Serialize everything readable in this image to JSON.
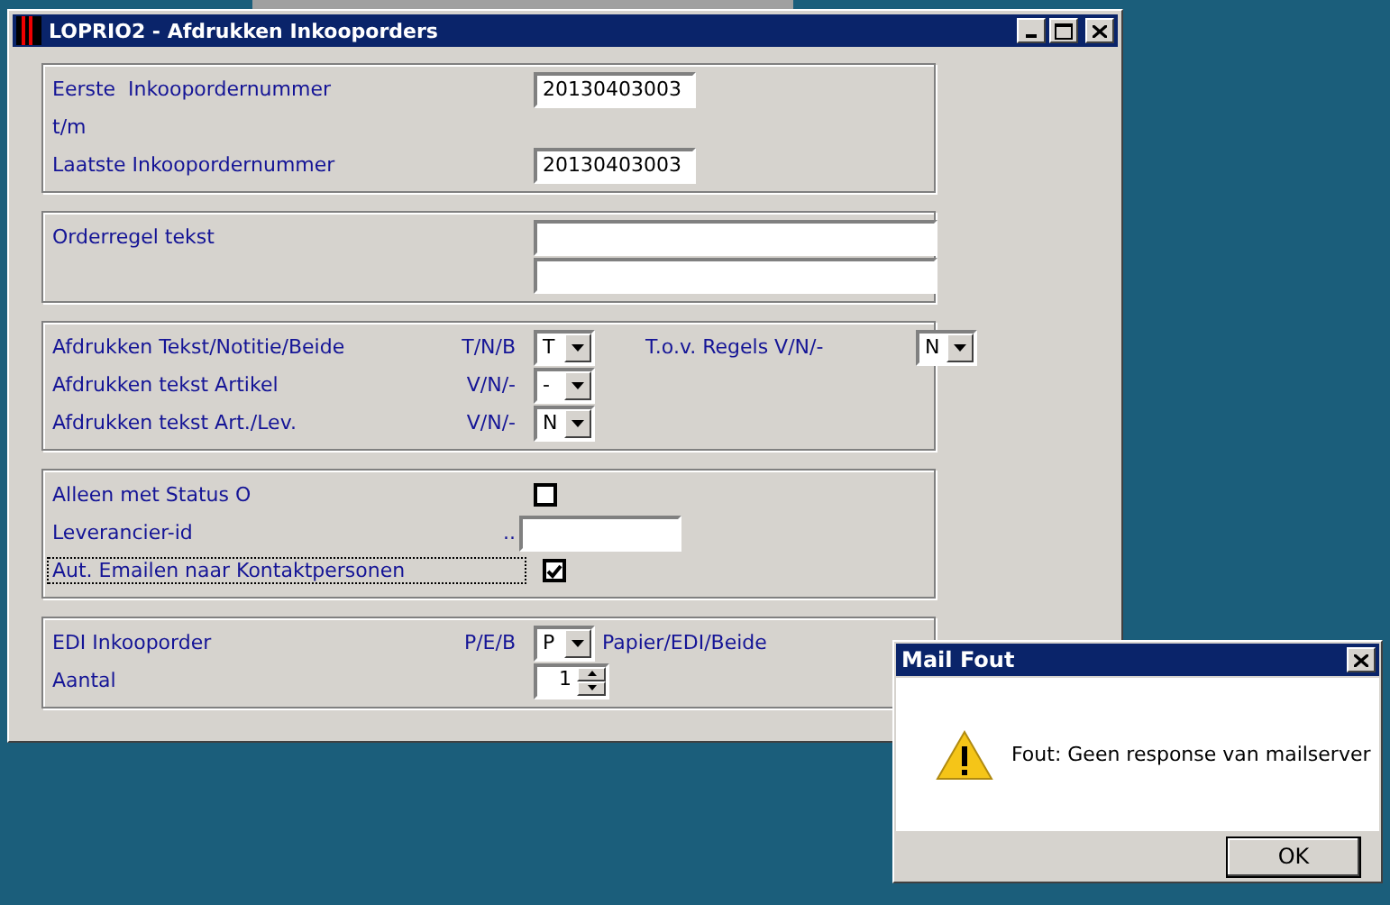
{
  "window": {
    "title": "LOPRIO2 - Afdrukken Inkooporders"
  },
  "order_range": {
    "first_label": "Eerste  Inkoopordernummer",
    "first_value": "20130403003",
    "between": "t/m",
    "last_label": "Laatste Inkoopordernummer",
    "last_value": "20130403003"
  },
  "orderline": {
    "label": "Orderregel tekst"
  },
  "print_options": [
    {
      "label": "Afdrukken Tekst/Notitie/Beide",
      "codes": "T/N/B",
      "value": "T"
    },
    {
      "label": "Afdrukken tekst Artikel",
      "codes": "V/N/-",
      "value": "-"
    },
    {
      "label": "Afdrukken tekst Art./Lev.",
      "codes": "V/N/-",
      "value": "N"
    }
  ],
  "rules_option": {
    "label": "T.o.v. Regels V/N/-",
    "value": "N"
  },
  "filters": {
    "status": {
      "label": "Alleen met Status O",
      "checked": false
    },
    "supplier": {
      "label": "Leverancier-id",
      "dots": ".."
    },
    "auto_email": {
      "label": "Aut. Emailen naar Kontaktpersonen",
      "checked": true,
      "focused": true
    }
  },
  "edi": {
    "label": "EDI Inkooporder",
    "codes": "P/E/B",
    "value": "P",
    "hint": "Papier/EDI/Beide"
  },
  "copies": {
    "label": "Aantal",
    "value": "1"
  },
  "dialog": {
    "title": "Mail Fout",
    "message": "Fout: Geen response van mailserver",
    "button": "OK"
  }
}
